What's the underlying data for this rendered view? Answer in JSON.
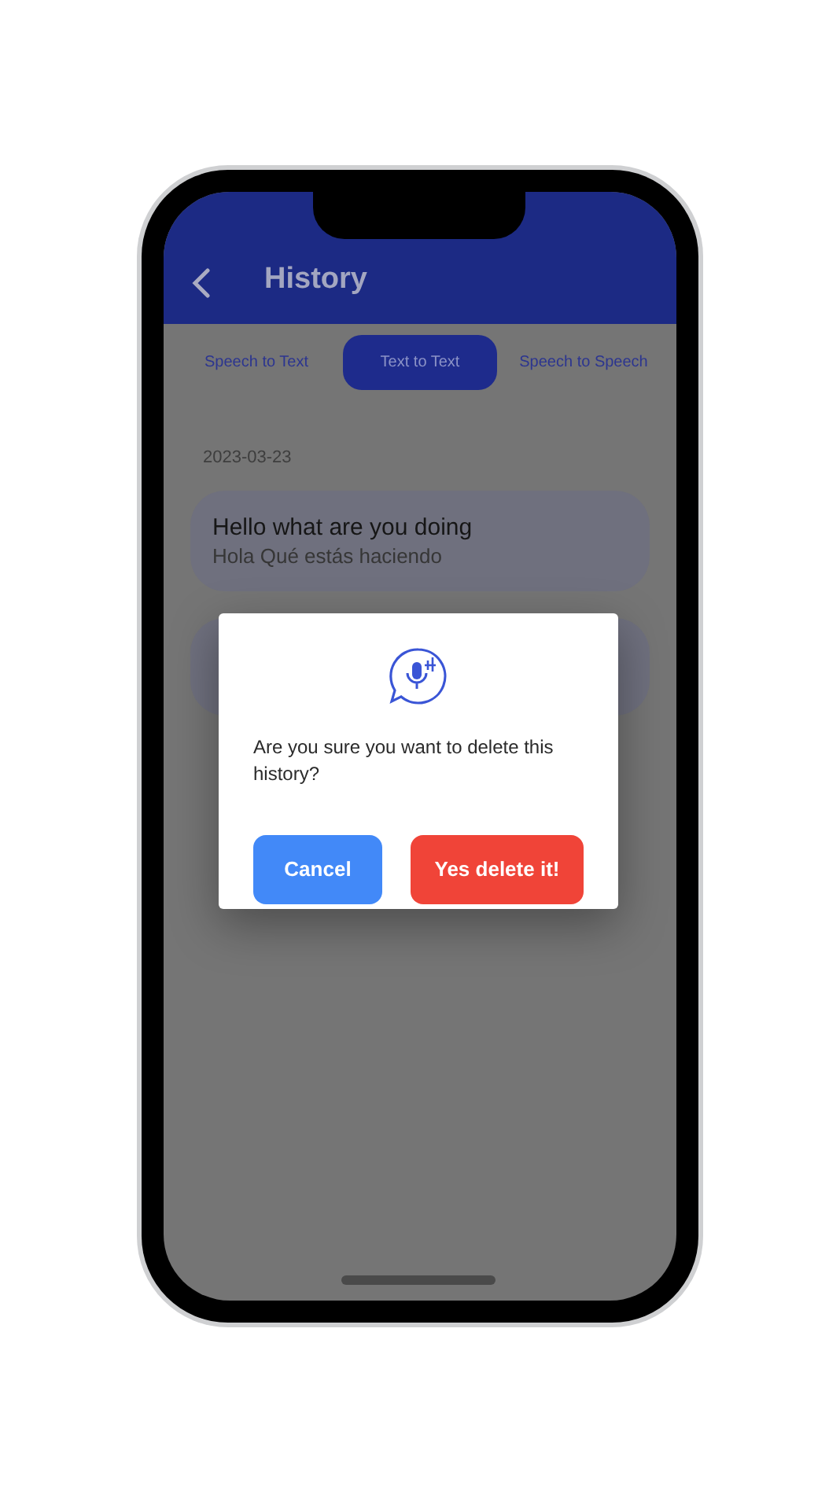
{
  "header": {
    "title": "History"
  },
  "tabs": [
    {
      "label": "Speech to Text",
      "selected": false
    },
    {
      "label": "Text to Text",
      "selected": true
    },
    {
      "label": "Speech to Speech",
      "selected": false
    }
  ],
  "history": {
    "date": "2023-03-23",
    "entries": [
      {
        "source": "Hello what are you doing",
        "translation": "Hola Qué estás haciendo"
      }
    ]
  },
  "dialog": {
    "message": "Are you sure you want to delete this history?",
    "buttons": [
      {
        "label": "Cancel",
        "kind": "cancel"
      },
      {
        "label": "Yes delete it!",
        "kind": "danger"
      }
    ]
  }
}
